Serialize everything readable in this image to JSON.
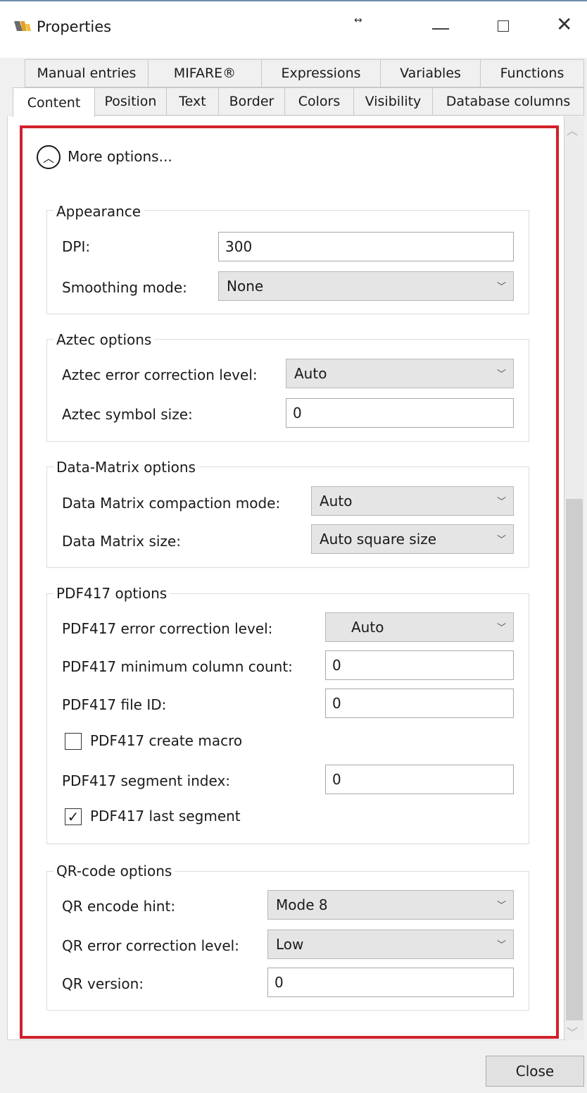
{
  "window": {
    "title": "Properties"
  },
  "tabs_row1": [
    "Manual entries",
    "MIFARE®",
    "Expressions",
    "Variables",
    "Functions"
  ],
  "tabs_row2": [
    "Content",
    "Position",
    "Text",
    "Border",
    "Colors",
    "Visibility",
    "Database columns"
  ],
  "active_tab": "Content",
  "more_options_label": "More options...",
  "appearance": {
    "title": "Appearance",
    "dpi_label": "DPI:",
    "dpi_value": "300",
    "smoothing_label": "Smoothing mode:",
    "smoothing_value": "None"
  },
  "aztec": {
    "title": "Aztec options",
    "ecl_label": "Aztec error correction level:",
    "ecl_value": "Auto",
    "size_label": "Aztec symbol size:",
    "size_value": "0"
  },
  "datamatrix": {
    "title": "Data-Matrix options",
    "compaction_label": "Data Matrix compaction mode:",
    "compaction_value": "Auto",
    "size_label": "Data Matrix size:",
    "size_value": "Auto square size"
  },
  "pdf417": {
    "title": "PDF417 options",
    "ecl_label": "PDF417 error correction level:",
    "ecl_value": "Auto",
    "mincol_label": "PDF417 minimum column count:",
    "mincol_value": "0",
    "fileid_label": "PDF417 file ID:",
    "fileid_value": "0",
    "macro_label": "PDF417 create macro",
    "macro_checked": false,
    "segidx_label": "PDF417 segment index:",
    "segidx_value": "0",
    "lastseg_label": "PDF417 last segment",
    "lastseg_checked": true
  },
  "qr": {
    "title": "QR-code options",
    "hint_label": "QR encode hint:",
    "hint_value": "Mode 8",
    "ecl_label": "QR error correction level:",
    "ecl_value": "Low",
    "version_label": "QR version:",
    "version_value": "0"
  },
  "footer": {
    "close_label": "Close"
  },
  "colors": {
    "highlight": "#d0202a",
    "window_bg": "#f0f0f0"
  }
}
